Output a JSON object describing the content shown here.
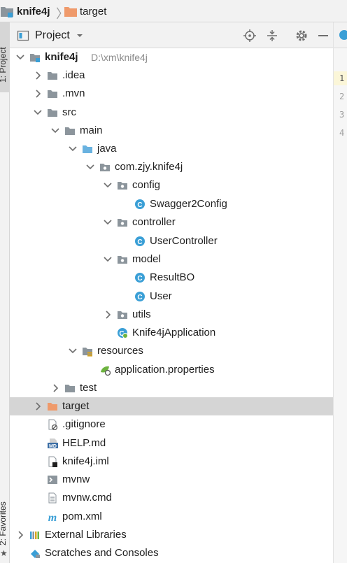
{
  "breadcrumb": {
    "project": "knife4j",
    "folder": "target"
  },
  "left_strip": {
    "project_tab": "1: Project",
    "favorites_tab": "2: Favorites"
  },
  "panel": {
    "title": "Project"
  },
  "tree": [
    {
      "label": "knife4j",
      "hint": "D:\\xm\\knife4j",
      "icon": "module-folder-icon",
      "arrow": "down",
      "bold": true
    },
    {
      "label": ".idea",
      "icon": "folder-icon",
      "arrow": "right"
    },
    {
      "label": ".mvn",
      "icon": "folder-icon",
      "arrow": "right"
    },
    {
      "label": "src",
      "icon": "folder-icon",
      "arrow": "down"
    },
    {
      "label": "main",
      "icon": "folder-icon",
      "arrow": "down"
    },
    {
      "label": "java",
      "icon": "source-folder-icon",
      "arrow": "down"
    },
    {
      "label": "com.zjy.knife4j",
      "icon": "package-icon",
      "arrow": "down"
    },
    {
      "label": "config",
      "icon": "package-icon",
      "arrow": "down"
    },
    {
      "label": "Swagger2Config",
      "icon": "class-icon",
      "arrow": "none"
    },
    {
      "label": "controller",
      "icon": "package-icon",
      "arrow": "down"
    },
    {
      "label": "UserController",
      "icon": "class-icon",
      "arrow": "none"
    },
    {
      "label": "model",
      "icon": "package-icon",
      "arrow": "down"
    },
    {
      "label": "ResultBO",
      "icon": "class-icon",
      "arrow": "none"
    },
    {
      "label": "User",
      "icon": "class-icon",
      "arrow": "none"
    },
    {
      "label": "utils",
      "icon": "package-icon",
      "arrow": "right"
    },
    {
      "label": "Knife4jApplication",
      "icon": "spring-boot-class-icon",
      "arrow": "none"
    },
    {
      "label": "resources",
      "icon": "resources-folder-icon",
      "arrow": "down"
    },
    {
      "label": "application.properties",
      "icon": "spring-properties-icon",
      "arrow": "none"
    },
    {
      "label": "test",
      "icon": "folder-icon",
      "arrow": "right"
    },
    {
      "label": "target",
      "icon": "excluded-folder-icon",
      "arrow": "right",
      "selected": true
    },
    {
      "label": ".gitignore",
      "icon": "ignored-file-icon",
      "arrow": "none"
    },
    {
      "label": "HELP.md",
      "icon": "markdown-file-icon",
      "arrow": "none"
    },
    {
      "label": "knife4j.iml",
      "icon": "iml-file-icon",
      "arrow": "none"
    },
    {
      "label": "mvnw",
      "icon": "shell-file-icon",
      "arrow": "none"
    },
    {
      "label": "mvnw.cmd",
      "icon": "text-file-icon",
      "arrow": "none"
    },
    {
      "label": "pom.xml",
      "icon": "maven-icon",
      "arrow": "none"
    },
    {
      "label": "External Libraries",
      "icon": "libraries-icon",
      "arrow": "right"
    },
    {
      "label": "Scratches and Consoles",
      "icon": "scratches-icon",
      "arrow": "none"
    }
  ],
  "editor": {
    "line_numbers": [
      "1",
      "2",
      "3",
      "4"
    ]
  },
  "colors": {
    "folder": "#8c959c",
    "source_folder": "#69b2e0",
    "class_badge": "#3a9fd6",
    "excluded_folder": "#ef9a6b",
    "selection": "#d5d5d5",
    "panel_bg": "#f2f2f2"
  }
}
